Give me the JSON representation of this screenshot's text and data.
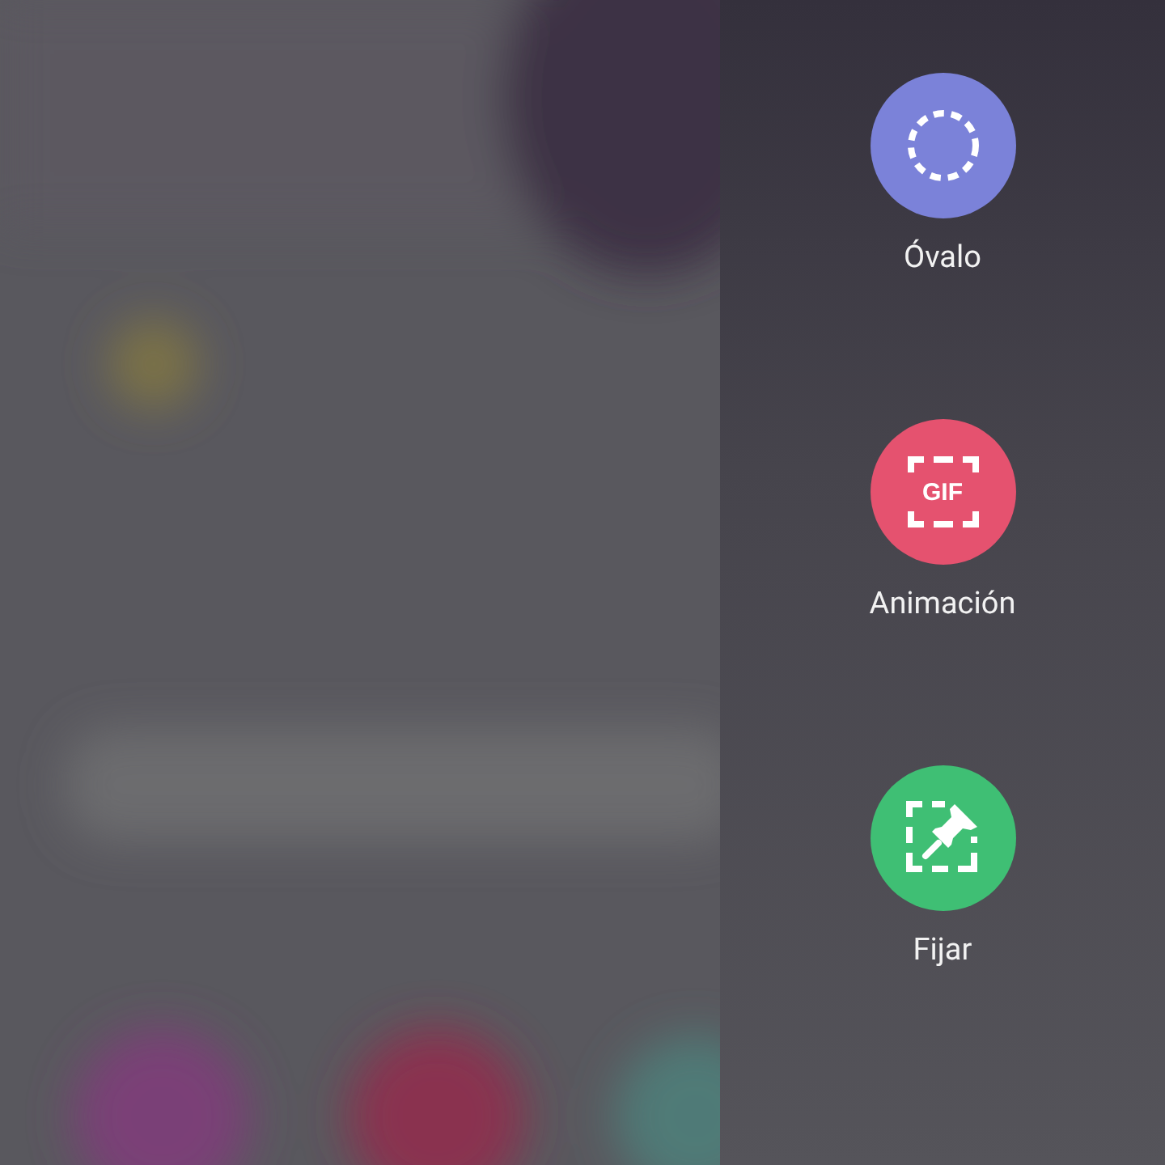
{
  "panel": {
    "actions": [
      {
        "kind": "oval",
        "label": "Óvalo",
        "color": "#7b82d9"
      },
      {
        "kind": "gif",
        "label": "Animación",
        "color": "#e5526f",
        "icon_text": "GIF"
      },
      {
        "kind": "pin",
        "label": "Fijar",
        "color": "#3fbf74"
      }
    ]
  }
}
